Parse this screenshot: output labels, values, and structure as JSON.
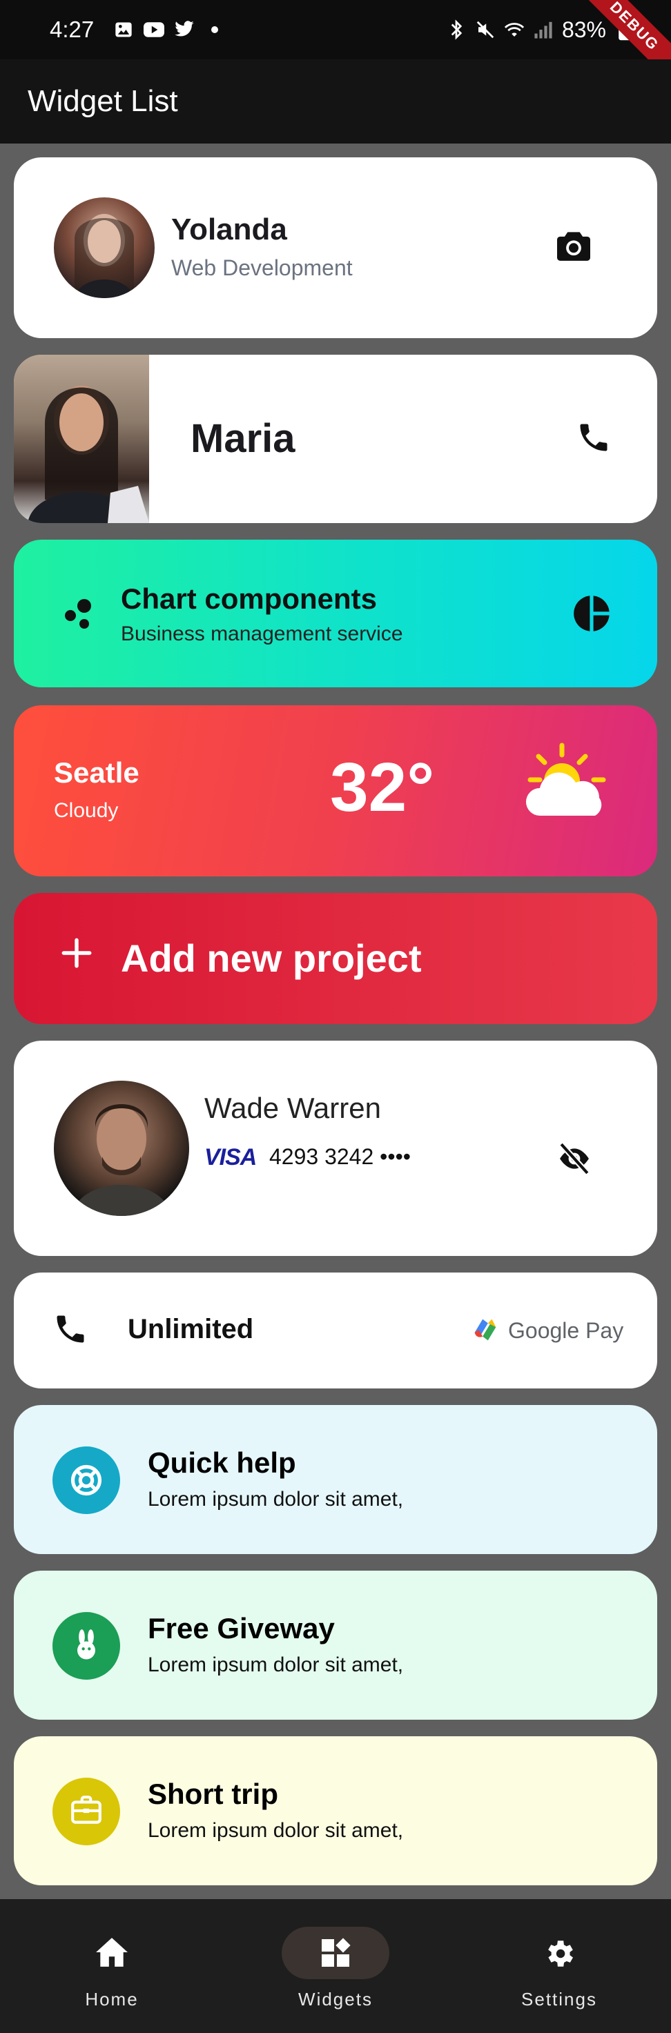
{
  "status_bar": {
    "time": "4:27",
    "battery": "83%",
    "debug": "DEBUG"
  },
  "app_bar": {
    "title": "Widget List"
  },
  "profile_card": {
    "name": "Yolanda",
    "subtitle": "Web Development",
    "icon": "camera-icon"
  },
  "contact_card": {
    "name": "Maria",
    "icon": "phone-icon"
  },
  "chart_card": {
    "title": "Chart components",
    "subtitle": "Business management service",
    "icon": "pie-chart-icon"
  },
  "weather_card": {
    "city": "Seatle",
    "condition": "Cloudy",
    "temperature": "32°",
    "icon": "partly-cloudy-icon"
  },
  "add_project_card": {
    "label": "Add new project"
  },
  "payment_card": {
    "name": "Wade Warren",
    "card_brand": "VISA",
    "card_number": "4293 3242 ••••",
    "icon": "eye-off-icon"
  },
  "unlimited_card": {
    "label": "Unlimited",
    "pay_label": "Google Pay"
  },
  "info_cards": [
    {
      "title": "Quick help",
      "subtitle": "Lorem ipsum dolor sit amet,",
      "icon": "lifebuoy-icon",
      "color": "#15a9c7"
    },
    {
      "title": "Free Giveway",
      "subtitle": "Lorem ipsum dolor sit amet,",
      "icon": "rabbit-icon",
      "color": "#1b9e55"
    },
    {
      "title": "Short trip",
      "subtitle": "Lorem ipsum dolor sit amet,",
      "icon": "briefcase-icon",
      "color": "#d9c607"
    }
  ],
  "bottom_nav": {
    "items": [
      {
        "label": "Home",
        "icon": "home-icon"
      },
      {
        "label": "Widgets",
        "icon": "widgets-icon",
        "active": true
      },
      {
        "label": "Settings",
        "icon": "gear-icon"
      }
    ]
  }
}
